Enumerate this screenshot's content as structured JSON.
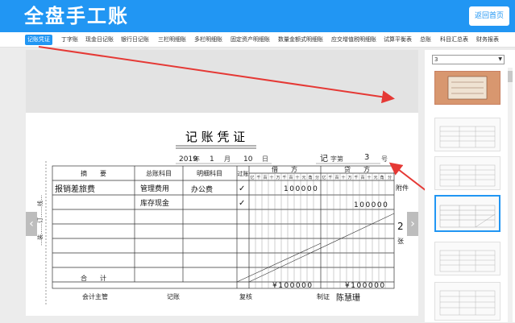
{
  "app": {
    "title": "全盘手工账",
    "home_button": "返回首页"
  },
  "tabs": [
    {
      "label": "记账凭证",
      "active": true
    },
    {
      "label": "丁字账"
    },
    {
      "label": "现金日记账"
    },
    {
      "label": "银行日记账"
    },
    {
      "label": "三栏明细账"
    },
    {
      "label": "多栏明细账"
    },
    {
      "label": "固定资产明细账"
    },
    {
      "label": "数量金额式明细账"
    },
    {
      "label": "应交增值税明细账"
    },
    {
      "label": "试算平衡表"
    },
    {
      "label": "总账"
    },
    {
      "label": "科目汇总表"
    },
    {
      "label": "财务报表"
    }
  ],
  "sidebar": {
    "page_select_value": "3"
  },
  "voucher": {
    "title": "记 账 凭 证",
    "year": "2019",
    "year_unit": "年",
    "month": "1",
    "month_unit": "月",
    "day": "10",
    "day_unit": "日",
    "word_type": "记",
    "word_label": "字第",
    "number": "3",
    "number_unit": "号",
    "headers": {
      "summary": "摘　　要",
      "account": "总账科目",
      "sub_account": "明细科目",
      "posted": "过账",
      "debit": "借　　方",
      "credit": "贷　　方"
    },
    "digit_headers": [
      "亿",
      "千",
      "百",
      "十",
      "万",
      "千",
      "百",
      "十",
      "元",
      "角",
      "分"
    ],
    "rows": [
      {
        "summary": "报销差旅费",
        "account": "管理费用",
        "sub_account": "办公费",
        "check": "✓",
        "debit": "100000",
        "credit": ""
      },
      {
        "summary": "",
        "account": "库存现金",
        "sub_account": "",
        "check": "✓",
        "debit": "",
        "credit": "100000"
      }
    ],
    "total_label": "合　　计",
    "total_debit": "¥100000",
    "total_credit": "¥100000",
    "attachment_label": "附件",
    "attachment_count": "2",
    "attachment_unit": "张",
    "margin_text": "…装……订……线…",
    "footer": {
      "supervisor_label": "会计主管",
      "bookkeeper_label": "记账",
      "reviewer_label": "复核",
      "preparer_label": "制证",
      "preparer_name": "陈慧珊"
    }
  },
  "colors": {
    "primary": "#2196f3",
    "annotation_arrow": "#e53935"
  }
}
